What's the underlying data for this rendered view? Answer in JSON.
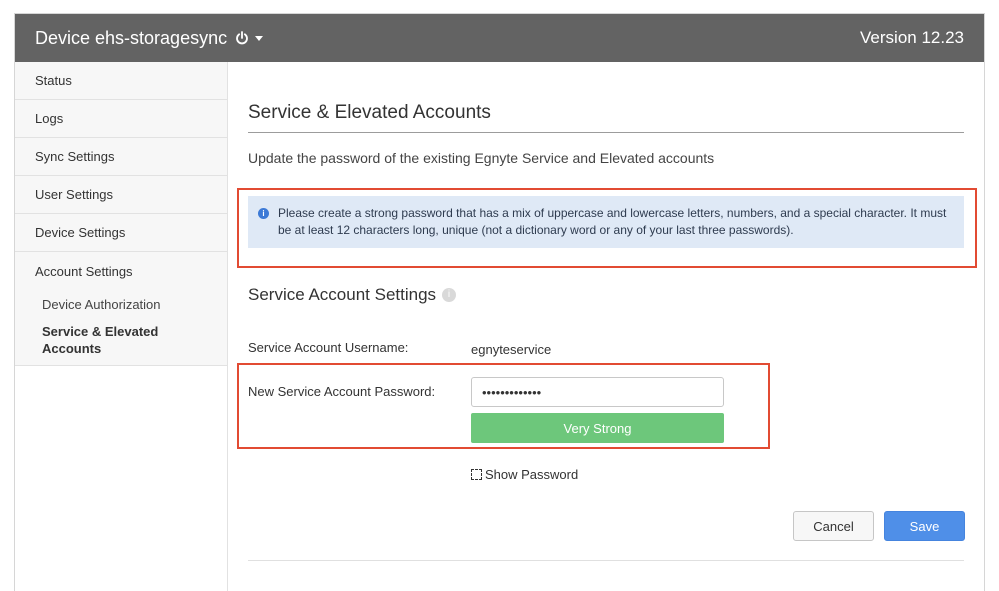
{
  "header": {
    "device_title": "Device ehs-storagesync",
    "version": "Version 12.23"
  },
  "sidebar": {
    "items": [
      {
        "label": "Status"
      },
      {
        "label": "Logs"
      },
      {
        "label": "Sync Settings"
      },
      {
        "label": "User Settings"
      },
      {
        "label": "Device Settings"
      },
      {
        "label": "Account Settings"
      }
    ],
    "subitems": [
      {
        "label": "Device Authorization"
      },
      {
        "label": "Service & Elevated Accounts"
      }
    ]
  },
  "main": {
    "page_title": "Service & Elevated Accounts",
    "subtitle": "Update the password of the existing Egnyte Service and Elevated accounts",
    "info_text": "Please create a strong password that has a mix of uppercase and lowercase letters, numbers, and a special character. It must be at least 12 characters long, unique (not a dictionary word or any of your last three passwords).",
    "section_title": "Service Account Settings",
    "username_label": "Service Account Username:",
    "username_value": "egnyteservice",
    "password_label": "New Service Account Password:",
    "password_value": "•••••••••••••",
    "strength_label": "Very Strong",
    "show_password_label": "Show Password",
    "cancel_label": "Cancel",
    "save_label": "Save"
  },
  "colors": {
    "header_bg": "#636363",
    "info_bg": "#dfe9f6",
    "strength_green": "#6dc77b",
    "save_blue": "#4f8fe8",
    "highlight_red": "#e24b33"
  }
}
